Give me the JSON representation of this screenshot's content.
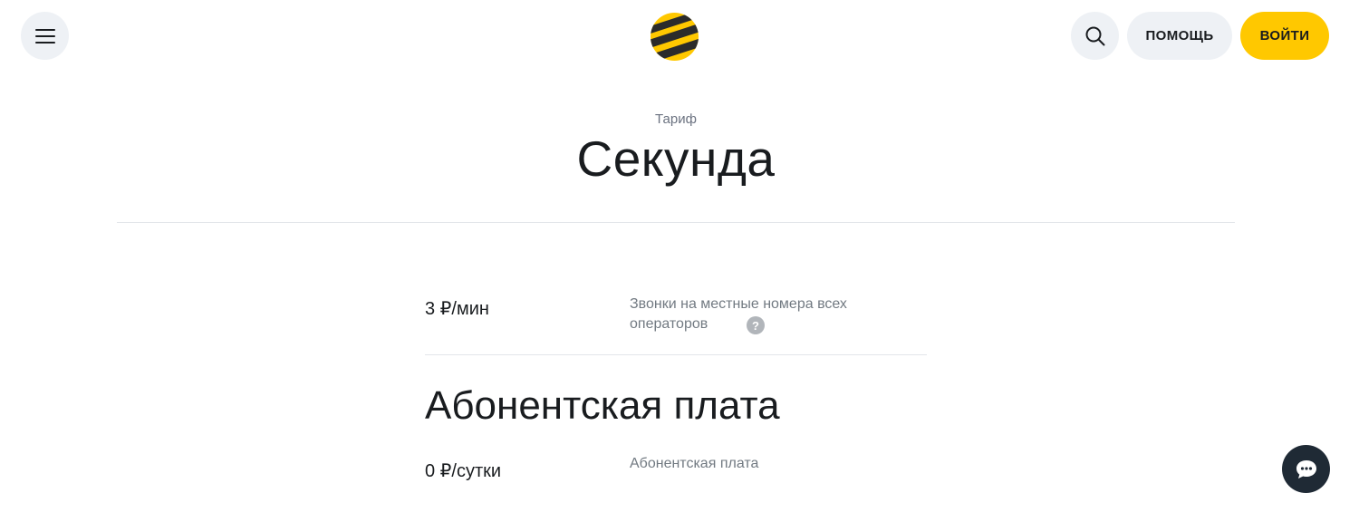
{
  "header": {
    "help_label": "ПОМОЩЬ",
    "login_label": "ВОЙТИ",
    "icons": {
      "menu": "hamburger-icon",
      "search": "search-icon",
      "logo": "beeline-logo"
    },
    "colors": {
      "accent": "#ffc800",
      "button_bg": "#eef1f5",
      "logo_dark": "#2b2b2b"
    }
  },
  "title": {
    "eyebrow": "Тариф",
    "heading": "Секунда"
  },
  "calls": {
    "price": "3 ₽/мин",
    "description": "Звонки на местные номера всех операторов",
    "help_symbol": "?"
  },
  "fee": {
    "section_title": "Абонентская плата",
    "price": "0 ₽/сутки",
    "description": "Абонентская плата"
  },
  "chat": {
    "icon": "chat-bubble-icon",
    "color": "#1f2a35"
  }
}
